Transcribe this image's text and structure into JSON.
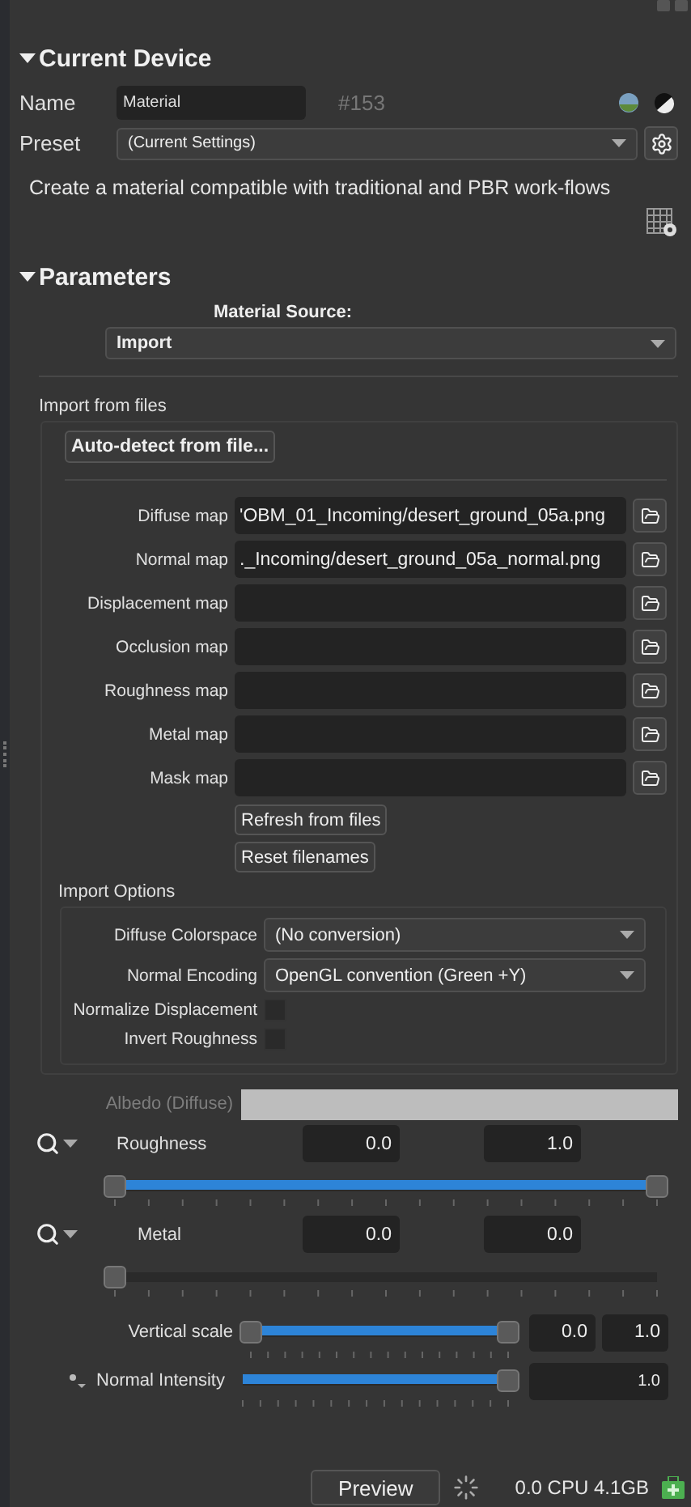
{
  "current_device": {
    "title": "Current Device",
    "expanded": true,
    "name_label": "Name",
    "name_value": "Material",
    "id": "#153",
    "preset_label": "Preset",
    "preset_value": "(Current Settings)",
    "description": "Create a material compatible with traditional and PBR work-flows"
  },
  "parameters": {
    "title": "Parameters",
    "expanded": true,
    "source_label": "Material Source:",
    "source_value": "Import",
    "import_heading": "Import from files",
    "autodetect_button": "Auto-detect from file...",
    "file_maps": [
      {
        "label": "Diffuse map",
        "value": "'OBM_01_Incoming/desert_ground_05a.png"
      },
      {
        "label": "Normal map",
        "value": "._Incoming/desert_ground_05a_normal.png"
      },
      {
        "label": "Displacement map"
      },
      {
        "label": "Occlusion map"
      },
      {
        "label": "Roughness map"
      },
      {
        "label": "Metal map"
      },
      {
        "label": "Mask map"
      }
    ],
    "file_buttons": [
      "Refresh from files",
      "Reset filenames"
    ],
    "options_heading": "Import Options",
    "options": [
      {
        "kind": "dropdown",
        "label": "Diffuse Colorspace",
        "value": "(No conversion)"
      },
      {
        "kind": "dropdown",
        "label": "Normal Encoding",
        "value": "OpenGL convention (Green +Y)"
      },
      {
        "kind": "checkbox",
        "label": "Normalize Displacement",
        "checked": false
      },
      {
        "kind": "checkbox",
        "label": "Invert Roughness",
        "checked": false
      }
    ],
    "albedo": {
      "label": "Albedo (Diffuse)",
      "disabled": true
    },
    "range_params": [
      {
        "label": "Roughness",
        "min": "0.0",
        "max": "1.0",
        "low_thumb": {
          "level": 0
        },
        "high_thumb": {
          "level": 1
        }
      },
      {
        "label": "Metal",
        "min": "0.0",
        "max": "0.0",
        "low_thumb": {
          "level": 0
        },
        "high_thumb": {
          "level": 0
        }
      }
    ],
    "sliders": [
      {
        "kind": "range",
        "label": "Vertical scale",
        "low_value": "0.0",
        "high_value": "1.0",
        "low_thumb": {
          "level": 0
        },
        "high_thumb": {
          "level": 1
        }
      },
      {
        "kind": "single",
        "label": "Normal Intensity",
        "value": "1.0",
        "thumb": {
          "level": 1
        }
      }
    ]
  },
  "status_bar": {
    "preview_button": "Preview",
    "stats": "0.0 CPU 4.1GB"
  }
}
